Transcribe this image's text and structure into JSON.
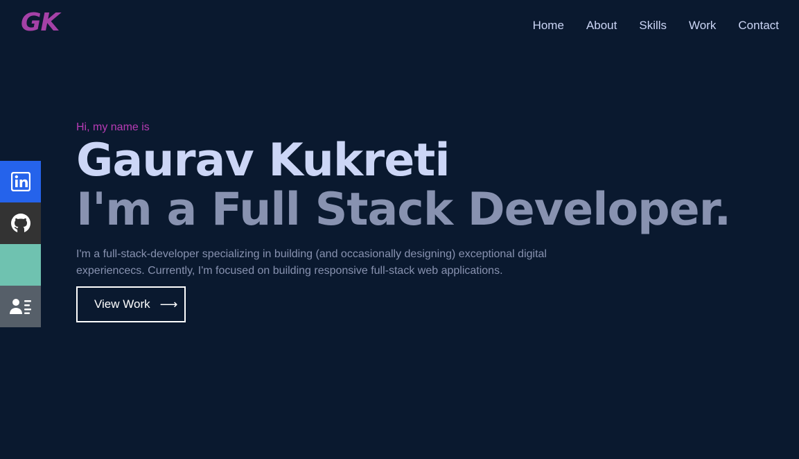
{
  "logo": {
    "text": "GK",
    "color": "#a541a7"
  },
  "nav": {
    "items": [
      {
        "label": "Home"
      },
      {
        "label": "About"
      },
      {
        "label": "Skills"
      },
      {
        "label": "Work"
      },
      {
        "label": "Contact"
      }
    ]
  },
  "social": {
    "items": [
      {
        "icon": "linkedin-icon",
        "color": "#2563eb"
      },
      {
        "icon": "github-icon",
        "color": "#333333"
      },
      {
        "icon": "mail-icon",
        "color": "#6fc2b0"
      },
      {
        "icon": "contact-card-icon",
        "color": "#565f69"
      }
    ]
  },
  "hero": {
    "greeting": "Hi, my name is",
    "name": "Gaurav Kukreti",
    "role": "I'm a Full Stack Developer.",
    "description": "I'm a full-stack-developer specializing in building (and occasionally designing) exceptional digital experiencecs. Currently, I'm focused on building responsive full-stack web applications.",
    "button_label": "View Work",
    "button_icon": "arrow-right-icon"
  },
  "colors": {
    "background": "#0a192f",
    "primary_text": "#ccd6f6",
    "secondary_text": "#8892b0",
    "accent": "#b83bb5"
  }
}
